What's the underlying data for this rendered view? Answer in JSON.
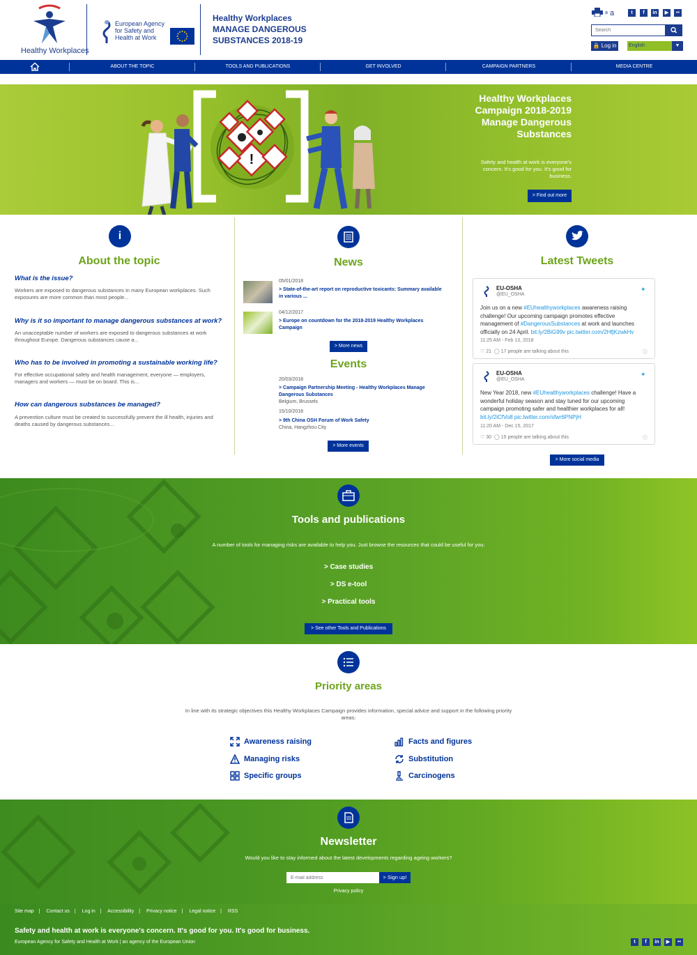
{
  "header": {
    "logo_label": "Healthy Workplaces",
    "agency_logo_text": "European Agency for Safety and Health at Work",
    "campaign_title_1": "Healthy Workplaces",
    "campaign_title_2": "MANAGE DANGEROUS",
    "campaign_title_3": "SUBSTANCES 2018-19",
    "font_small": "a",
    "font_big": "a",
    "social": [
      "t",
      "f",
      "in",
      "▶",
      "••"
    ],
    "search_placeholder": "Search",
    "login_label": "Log in",
    "language": "English"
  },
  "nav": {
    "items": [
      "ABOUT THE TOPIC",
      "TOOLS AND PUBLICATIONS",
      "GET INVOLVED",
      "CAMPAIGN PARTNERS",
      "MEDIA CENTRE"
    ]
  },
  "hero": {
    "title_1": "Healthy Workplaces",
    "title_2": "Campaign 2018-2019",
    "title_3": "Manage Dangerous",
    "title_4": "Substances",
    "text": "Safety and health at work is everyone's concern. It's good for you. It's good for business.",
    "button": "> Find out more"
  },
  "about": {
    "title": "About the topic",
    "items": [
      {
        "q": "What is the issue?",
        "t": "Workers are exposed to dangerous substances in many European workplaces. Such exposures are more common than most people..."
      },
      {
        "q": "Why is it so important to manage dangerous substances at work?",
        "t": "An unacceptable number of workers are exposed to dangerous substances at work throughout Europe. Dangerous substances cause a..."
      },
      {
        "q": "Who has to be involved in promoting a sustainable working life?",
        "t": "For effective occupational safety and health management, everyone — employers, managers and workers — must be on board. This is..."
      },
      {
        "q": "How can dangerous substances be managed?",
        "t": "A prevention culture must be created to successfully prevent the ill health, injuries and deaths caused by dangerous substances..."
      }
    ]
  },
  "news": {
    "title": "News",
    "items": [
      {
        "date": "05/01/2018",
        "title": "> State-of-the-art report on reproductive toxicants: Summary available in various ..."
      },
      {
        "date": "04/12/2017",
        "title": "> Europe on countdown for the 2018-2019 Healthy Workplaces Campaign"
      }
    ],
    "more": ">  More news"
  },
  "events": {
    "title": "Events",
    "items": [
      {
        "date": "20/03/2018",
        "title": "> Campaign Partnership Meeting - Healthy Workplaces Manage Dangerous Substances",
        "loc": "Belgium, Brussels"
      },
      {
        "date": "15/10/2018",
        "title": "> 9th China OSH Forum of Work Safety",
        "loc": "China, Hangzhou City"
      }
    ],
    "more": ">  More events"
  },
  "tweets": {
    "title": "Latest Tweets",
    "items": [
      {
        "name": "EU-OSHA",
        "handle": "@EU_OSHA",
        "p1": "Join us on a new ",
        "h1": "#EUhealthyworkplaces",
        "p2": " awareness raising challenge! Our upcoming campaign promotes effective management of ",
        "h2": "#DangerousSubstances",
        "p3": " at work and launches officially on 24 April. ",
        "h3": "bit.ly/2BiG99v pic.twitter.com/2HfjKzwkHv",
        "time": "11:25 AM - Feb 13, 2018",
        "likes": "21",
        "talking": "17 people are talking about this"
      },
      {
        "name": "EU-OSHA",
        "handle": "@EU_OSHA",
        "p1": "New Year 2018, new ",
        "h1": "#EUhealthyworkplaces",
        "p2": " challenge! Have a wonderful holiday season and stay tuned for our upcoming campaign promoting safer and healthier workplaces for all! ",
        "h2": "",
        "p3": "",
        "h3": "bit.ly/2iCfVo8 pic.twitter.com/sfwr6PNPjH",
        "time": "11:20 AM - Dec 15, 2017",
        "likes": "30",
        "talking": "15 people are talking about this"
      }
    ],
    "more": ">  More social media"
  },
  "tools": {
    "title": "Tools and publications",
    "desc": "A number of tools for managing risks are available to help you. Just browse the resources that could be useful for you:",
    "links": [
      "> Case studies",
      "> DS e-tool",
      "> Practical tools"
    ],
    "button": "> See other Tools and Publications"
  },
  "priority": {
    "title": "Priority areas",
    "desc": "In line with its strategic objectives this Healthy Workplaces Campaign provides information, special advice and support in the following priority areas:",
    "items": [
      "Awareness raising",
      "Facts and figures",
      "Managing risks",
      "Substitution",
      "Specific groups",
      "Carcinogens"
    ]
  },
  "newsletter": {
    "title": "Newsletter",
    "desc": "Would you like to stay informed about the latest developments regarding ageing workers?",
    "placeholder": "E-mail address",
    "button": "> Sign up!",
    "privacy": "Privacy policy"
  },
  "footer": {
    "links": [
      "Site map",
      "Contact us",
      "Log in",
      "Accessibility",
      "Privacy notice",
      "Legal notice",
      "RSS"
    ],
    "slogan": "Safety and health at work is everyone's concern. It's good for you. It's good for business.",
    "agency": "European Agency for Safety and Health at Work | an agency of the European Union"
  },
  "colors": {
    "navy": "#003399",
    "green": "#6ca41a",
    "lime": "#90be27"
  }
}
